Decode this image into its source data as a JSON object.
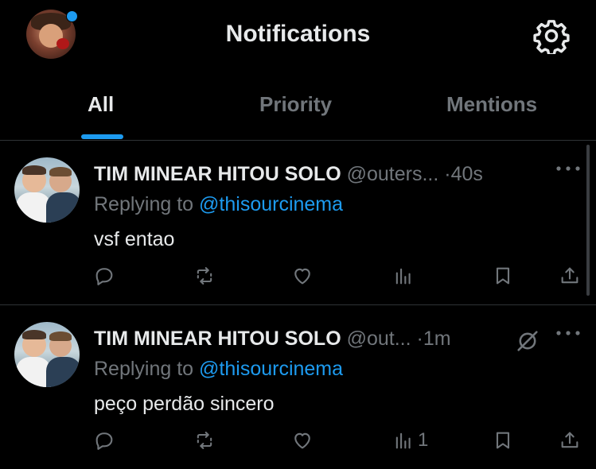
{
  "header": {
    "title": "Notifications",
    "unread_indicator_color": "#1d9bf0",
    "settings_icon": "gear-icon"
  },
  "tabs": [
    {
      "label": "All",
      "active": true
    },
    {
      "label": "Priority",
      "active": false
    },
    {
      "label": "Mentions",
      "active": false
    }
  ],
  "accent_color": "#1d9bf0",
  "posts": [
    {
      "author_name": "TIM MINEAR HITOU SOLO",
      "handle": "@outers...",
      "separator": "·",
      "time": "40s",
      "reply_prefix": "Replying to",
      "reply_to": "@thisourcinema",
      "text": "vsf entao",
      "views": "",
      "has_grok_icon": false
    },
    {
      "author_name": "TIM MINEAR HITOU SOLO",
      "handle": "@out...",
      "separator": "·",
      "time": "1m",
      "reply_prefix": "Replying to",
      "reply_to": "@thisourcinema",
      "text": "peço perdão sincero",
      "views": "1",
      "has_grok_icon": true
    }
  ]
}
